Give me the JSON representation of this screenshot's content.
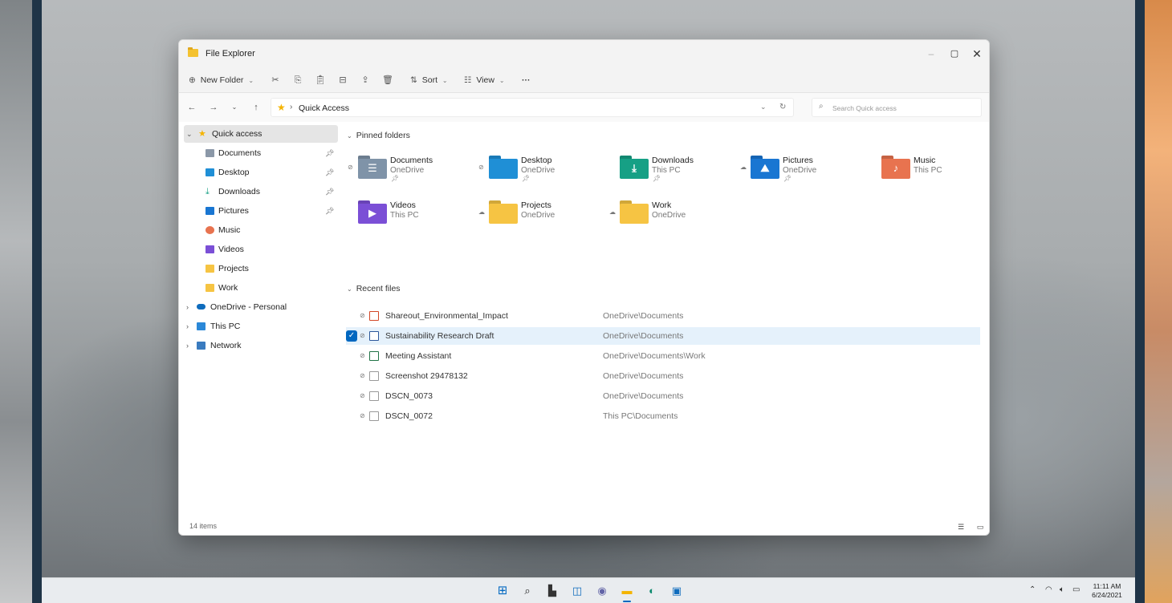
{
  "window": {
    "title": "File Explorer",
    "controls": {
      "minimize": "–",
      "maximize": "▢",
      "close": "✕"
    }
  },
  "toolbar": {
    "new_folder": "New Folder",
    "sort": "Sort",
    "view": "View",
    "more": "···"
  },
  "address": {
    "path": "Quick Access",
    "search_placeholder": "Search Quick access"
  },
  "sidebar": {
    "items": [
      {
        "label": "Quick access",
        "icon": "star-icon"
      },
      {
        "label": "Documents",
        "icon": "documents-icon"
      },
      {
        "label": "Desktop",
        "icon": "desktop-icon"
      },
      {
        "label": "Downloads",
        "icon": "downloads-icon"
      },
      {
        "label": "Pictures",
        "icon": "pictures-icon"
      },
      {
        "label": "Music",
        "icon": "music-icon"
      },
      {
        "label": "Videos",
        "icon": "videos-icon"
      },
      {
        "label": "Projects",
        "icon": "folder-icon"
      },
      {
        "label": "Work",
        "icon": "folder-icon"
      },
      {
        "label": "OneDrive - Personal",
        "icon": "onedrive-icon"
      },
      {
        "label": "This PC",
        "icon": "computer-icon"
      },
      {
        "label": "Network",
        "icon": "network-icon"
      }
    ]
  },
  "pinned": {
    "header": "Pinned folders",
    "folders": [
      {
        "name": "Documents",
        "location": "OneDrive",
        "color": "#7f93a8"
      },
      {
        "name": "Desktop",
        "location": "OneDrive",
        "color": "#1f8fd6"
      },
      {
        "name": "Downloads",
        "location": "This PC",
        "color": "#16a085"
      },
      {
        "name": "Pictures",
        "location": "OneDrive",
        "color": "#1976d2"
      },
      {
        "name": "Music",
        "location": "This PC",
        "color": "#e8734f"
      },
      {
        "name": "Videos",
        "location": "This PC",
        "color": "#7b4fd6"
      },
      {
        "name": "Projects",
        "location": "OneDrive",
        "color": "#f6c443"
      },
      {
        "name": "Work",
        "location": "OneDrive",
        "color": "#f6c443"
      }
    ]
  },
  "recent": {
    "header": "Recent files",
    "files": [
      {
        "name": "Shareout_Environmental_Impact",
        "path": "OneDrive\\Documents"
      },
      {
        "name": "Sustainability Research Draft",
        "path": "OneDrive\\Documents"
      },
      {
        "name": "Meeting Assistant",
        "path": "OneDrive\\Documents\\Work"
      },
      {
        "name": "Screenshot 29478132",
        "path": "OneDrive\\Documents"
      },
      {
        "name": "DSCN_0073",
        "path": "OneDrive\\Documents"
      },
      {
        "name": "DSCN_0072",
        "path": "This PC\\Documents"
      }
    ]
  },
  "status": {
    "items": "14 items"
  },
  "taskbar": {
    "time": "11:11 AM",
    "date": "6/24/2021",
    "accent": "#0067c0"
  }
}
